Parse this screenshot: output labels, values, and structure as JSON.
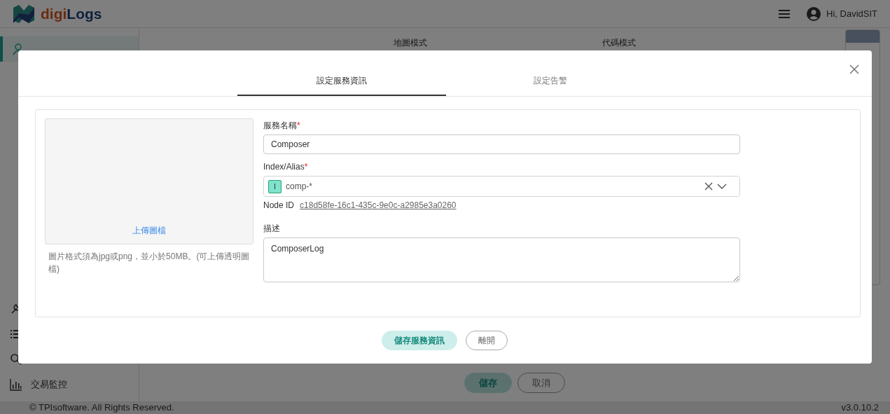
{
  "header": {
    "logo": {
      "prefix": "digi",
      "suffix": "Logs"
    },
    "user": "Hi, DavidSIT"
  },
  "sidebar": {
    "items": [
      {
        "selected": true
      },
      {
        "selected": false
      },
      {
        "selected": false
      },
      {
        "selected": false
      },
      {
        "label": "交易監控",
        "selected": false
      }
    ]
  },
  "main": {
    "tabs": [
      "地圖模式",
      "代碼模式"
    ],
    "buttons": [
      {
        "label": "儲存",
        "kind": "primary"
      },
      {
        "label": "取消",
        "kind": "secondary"
      }
    ]
  },
  "footer": {
    "copyright": "© TPIsoftware. All Rights Reserved.",
    "version": "v3.0.10.2"
  },
  "dialog": {
    "tabs": [
      {
        "label": "設定服務資訊",
        "selected": true
      },
      {
        "label": "設定告警",
        "selected": false
      }
    ],
    "upload": {
      "link": "上傳圖檔",
      "hint": "圖片格式須為jpg或png，並小於50MB。(可上傳透明圖檔)"
    },
    "fields": [
      {
        "kind": "text",
        "label": "服務名稱",
        "required_mark": "*",
        "value": "Composer"
      },
      {
        "kind": "tags",
        "label": "Index/Alias",
        "required_mark": "*",
        "tags": [
          {
            "badge": "I",
            "text": "comp-*"
          }
        ],
        "node_id": {
          "label": "Node ID",
          "value": "c18d58fe-16c1-435c-9e0c-a2985e3a0260"
        }
      },
      {
        "kind": "textarea",
        "label": "描述",
        "value": "ComposerLog"
      }
    ],
    "buttons": [
      {
        "label": "儲存服務資訊",
        "kind": "primary"
      },
      {
        "label": "離開",
        "kind": "secondary"
      }
    ]
  }
}
